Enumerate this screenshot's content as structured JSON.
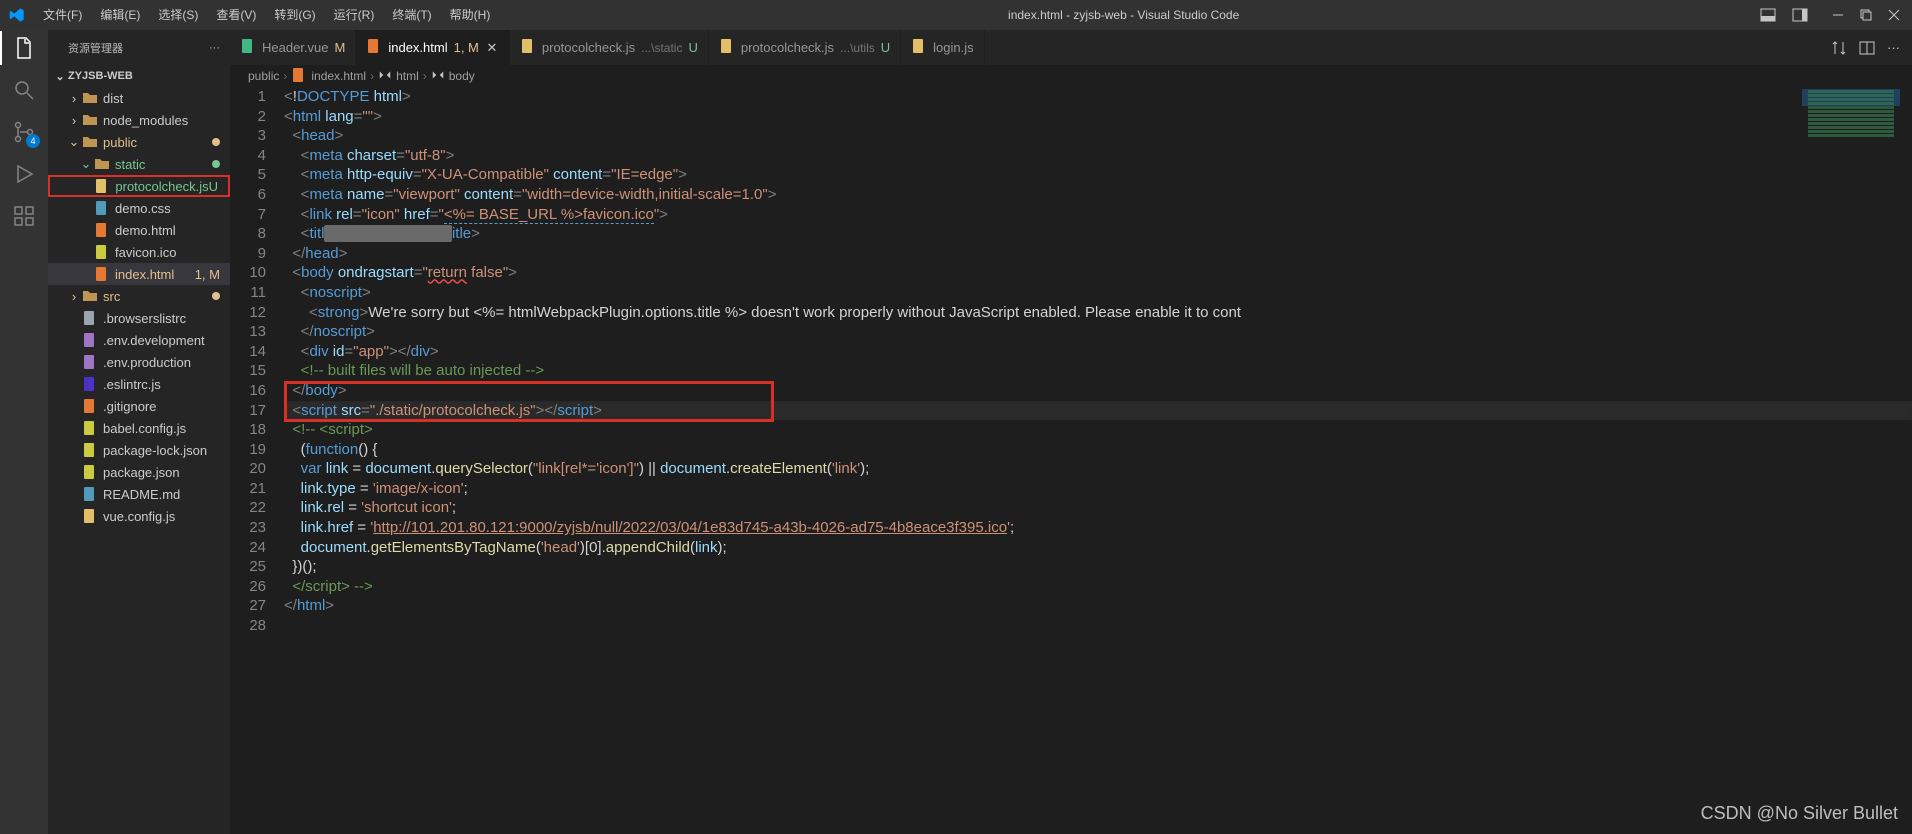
{
  "title": "index.html - zyjsb-web - Visual Studio Code",
  "menus": [
    "文件(F)",
    "编辑(E)",
    "选择(S)",
    "查看(V)",
    "转到(G)",
    "运行(R)",
    "终端(T)",
    "帮助(H)"
  ],
  "activity_badge": "4",
  "sidebar": {
    "title": "资源管理器",
    "project": "ZYJSB-WEB",
    "tree": [
      {
        "name": "dist",
        "kind": "folder",
        "depth": 1,
        "chev": ">"
      },
      {
        "name": "node_modules",
        "kind": "folder",
        "depth": 1,
        "chev": ">"
      },
      {
        "name": "public",
        "kind": "folder",
        "depth": 1,
        "chev": "v",
        "git": "m",
        "dot": true
      },
      {
        "name": "static",
        "kind": "folder",
        "depth": 2,
        "chev": "v",
        "git": "u",
        "dot": true
      },
      {
        "name": "protocolcheck.js",
        "kind": "js",
        "depth": 3,
        "git": "u",
        "status": "U",
        "boxed": true
      },
      {
        "name": "demo.css",
        "kind": "css",
        "depth": 2
      },
      {
        "name": "demo.html",
        "kind": "html",
        "depth": 2
      },
      {
        "name": "favicon.ico",
        "kind": "ico",
        "depth": 2
      },
      {
        "name": "index.html",
        "kind": "html",
        "depth": 2,
        "git": "m",
        "status": "1, M",
        "selected": true
      },
      {
        "name": "src",
        "kind": "folder",
        "depth": 1,
        "chev": ">",
        "git": "m",
        "dot": true
      },
      {
        "name": ".browserslistrc",
        "kind": "file",
        "depth": 1
      },
      {
        "name": ".env.development",
        "kind": "env",
        "depth": 1
      },
      {
        "name": ".env.production",
        "kind": "env",
        "depth": 1
      },
      {
        "name": ".eslintrc.js",
        "kind": "eslint",
        "depth": 1
      },
      {
        "name": ".gitignore",
        "kind": "git",
        "depth": 1
      },
      {
        "name": "babel.config.js",
        "kind": "babel",
        "depth": 1
      },
      {
        "name": "package-lock.json",
        "kind": "json",
        "depth": 1
      },
      {
        "name": "package.json",
        "kind": "json",
        "depth": 1
      },
      {
        "name": "README.md",
        "kind": "md",
        "depth": 1
      },
      {
        "name": "vue.config.js",
        "kind": "js",
        "depth": 1
      }
    ]
  },
  "tabs": [
    {
      "icon": "vue",
      "label": "Header.vue",
      "status": "M",
      "statusClass": "m"
    },
    {
      "icon": "html",
      "label": "index.html",
      "status": "1, M",
      "statusClass": "m",
      "active": true,
      "close": true
    },
    {
      "icon": "js",
      "label": "protocolcheck.js",
      "path": "...\\static",
      "status": "U",
      "statusClass": "u"
    },
    {
      "icon": "js",
      "label": "protocolcheck.js",
      "path": "...\\utils",
      "status": "U",
      "statusClass": "u"
    },
    {
      "icon": "js",
      "label": "login.js"
    }
  ],
  "breadcrumbs": [
    "public",
    "index.html",
    "html",
    "body"
  ],
  "breadcrumb_icons": [
    "",
    "html",
    "tag",
    "tag"
  ],
  "code_lines": 28,
  "watermark": "CSDN @No Silver Bullet",
  "code": {
    "charset": "utf-8",
    "compat_key": "X-UA-Compatible",
    "compat_val": "IE=edge",
    "vp_name": "viewport",
    "vp_content": "width=device-width,initial-scale=1.0",
    "icon_rel": "icon",
    "icon_href": "<%= BASE_URL %>favicon.ico",
    "ondrag": "return false",
    "sorry": "We're sorry but <%= htmlWebpackPlugin.options.title %> doesn't work properly without JavaScript enabled. Please enable it to cont",
    "app_id": "app",
    "built_comment": "<!-- built files will be auto injected -->",
    "script_src": "./static/protocolcheck.js",
    "link_href_url": "http://101.201.80.121:9000/zyjsb/null/2022/03/04/1e83d745-a43b-4026-ad75-4b8eace3f395.ico",
    "link_type": "image/x-icon",
    "link_rel": "shortcut icon",
    "qs_arg": "link[rel*='icon']",
    "ce_arg": "link",
    "gbt_arg": "head"
  }
}
